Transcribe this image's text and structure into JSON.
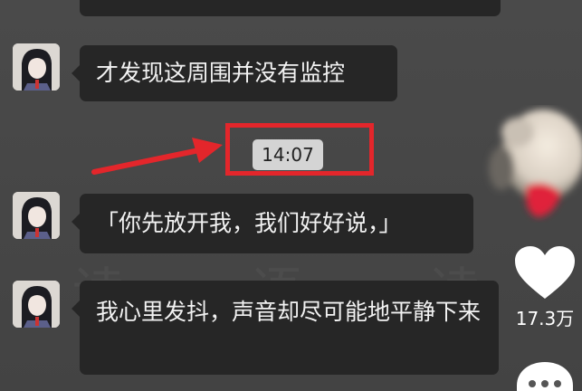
{
  "messages": [
    {
      "text": ""
    },
    {
      "text": "才发现这周围并没有监控"
    },
    {
      "text": "「你先放开我，我们好好说，」"
    },
    {
      "text": "我心里发抖，声音却尽可能地平静下来"
    }
  ],
  "timestamp": "14:07",
  "watermark": "读 语 读",
  "sidebar": {
    "like_count": "17.3万"
  },
  "colors": {
    "annotation": "#e3262b",
    "bubble": "#262626",
    "background": "#484848"
  }
}
